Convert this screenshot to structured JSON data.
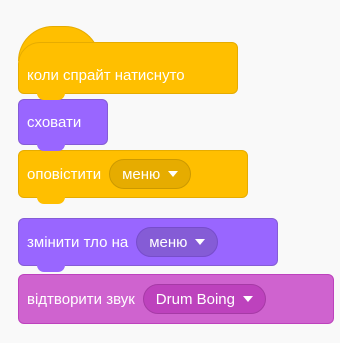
{
  "blocks": {
    "when_clicked": {
      "label": "коли спрайт натиснуто",
      "color": "#ffbf00"
    },
    "hide": {
      "label": "сховати",
      "color": "#9966ff"
    },
    "broadcast": {
      "label": "оповістити",
      "dropdown": "меню",
      "color": "#ffbf00",
      "dropdown_icon": "dropdown-arrow-icon"
    },
    "switch_backdrop": {
      "label": "змінити тло на",
      "dropdown": "меню",
      "color": "#9966ff",
      "dropdown_icon": "dropdown-arrow-icon"
    },
    "play_sound": {
      "label": "відтворити звук",
      "dropdown": "Drum Boing",
      "color": "#cf63cf",
      "dropdown_icon": "dropdown-arrow-icon"
    }
  }
}
